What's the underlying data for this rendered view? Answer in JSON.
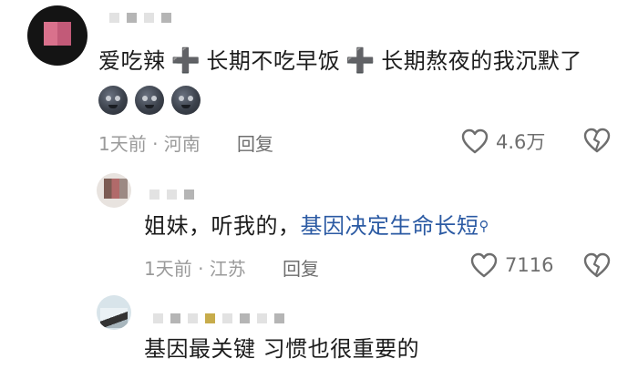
{
  "comments": [
    {
      "text_a": "爱吃辣",
      "plus1": "➕",
      "text_b": "长期不吃早饭",
      "plus2": "➕",
      "text_c": "长期熬夜的我沉默了",
      "emojis": [
        "😶",
        "😶",
        "😶"
      ],
      "meta": "1天前 · 河南",
      "reply": "回复",
      "likes": "4.6万"
    },
    {
      "text": "姐妹，听我的，",
      "link": "基因决定生命长短",
      "meta": "1天前 · 江苏",
      "reply": "回复",
      "likes": "7116"
    },
    {
      "text": "基因最关键 习惯也很重要的"
    }
  ],
  "icons": {
    "like": "heart-outline-icon",
    "dislike": "broken-heart-icon",
    "search": "search-icon"
  },
  "colors": {
    "link": "#2b5aa3",
    "meta": "#9a9a9a"
  }
}
